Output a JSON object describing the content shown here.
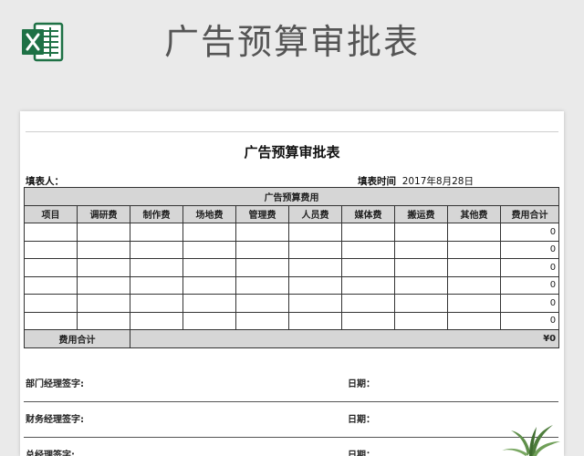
{
  "header": {
    "title": "广告预算审批表"
  },
  "form": {
    "title": "广告预算审批表",
    "filler_label": "填表人：",
    "time_label": "填表时间",
    "time_value": "2017年8月28日",
    "section_label": "广告预算费用",
    "columns": [
      "项目",
      "调研费",
      "制作费",
      "场地费",
      "管理费",
      "人员费",
      "媒体费",
      "搬运费",
      "其他费",
      "费用合计"
    ],
    "row_totals": [
      "0",
      "0",
      "0",
      "0",
      "0",
      "0"
    ],
    "grand_total_label": "费用合计",
    "grand_total_value": "¥0"
  },
  "signatures": [
    {
      "label": "部门经理签字:",
      "date_label": "日期："
    },
    {
      "label": "财务经理签字:",
      "date_label": "日期："
    },
    {
      "label": "总经理签字:",
      "date_label": "日期："
    }
  ],
  "colors": {
    "excel_green": "#1e7145",
    "header_gray": "#d6d6d6"
  }
}
